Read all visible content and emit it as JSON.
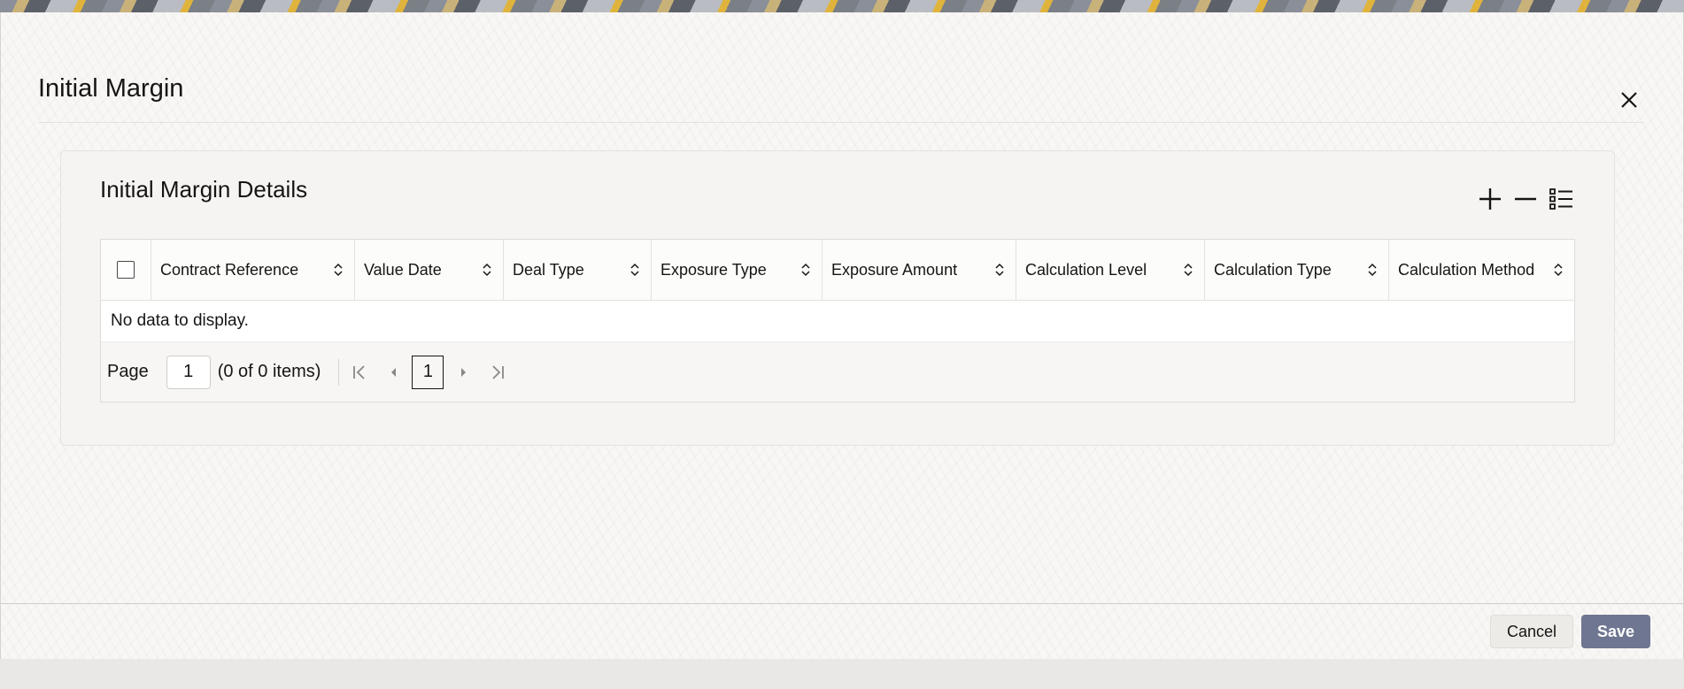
{
  "dialog": {
    "title": "Initial Margin",
    "close_icon": "close-icon"
  },
  "panel": {
    "title": "Initial Margin Details",
    "tools": {
      "add_icon": "plus-icon",
      "remove_icon": "minus-icon",
      "columns_icon": "list-columns-icon"
    }
  },
  "grid": {
    "columns": [
      "Contract Reference",
      "Value Date",
      "Deal Type",
      "Exposure Type",
      "Exposure Amount",
      "Calculation Level",
      "Calculation Type",
      "Calculation Method"
    ],
    "empty_message": "No data to display."
  },
  "pager": {
    "page_label": "Page",
    "page_value": "1",
    "count_text": "(0 of 0 items)",
    "current_page": "1"
  },
  "footer": {
    "cancel_label": "Cancel",
    "save_label": "Save"
  },
  "colors": {
    "save_button": "#6f7691",
    "panel_bg": "#f5f4f2",
    "dialog_bg": "#f8f7f5"
  }
}
